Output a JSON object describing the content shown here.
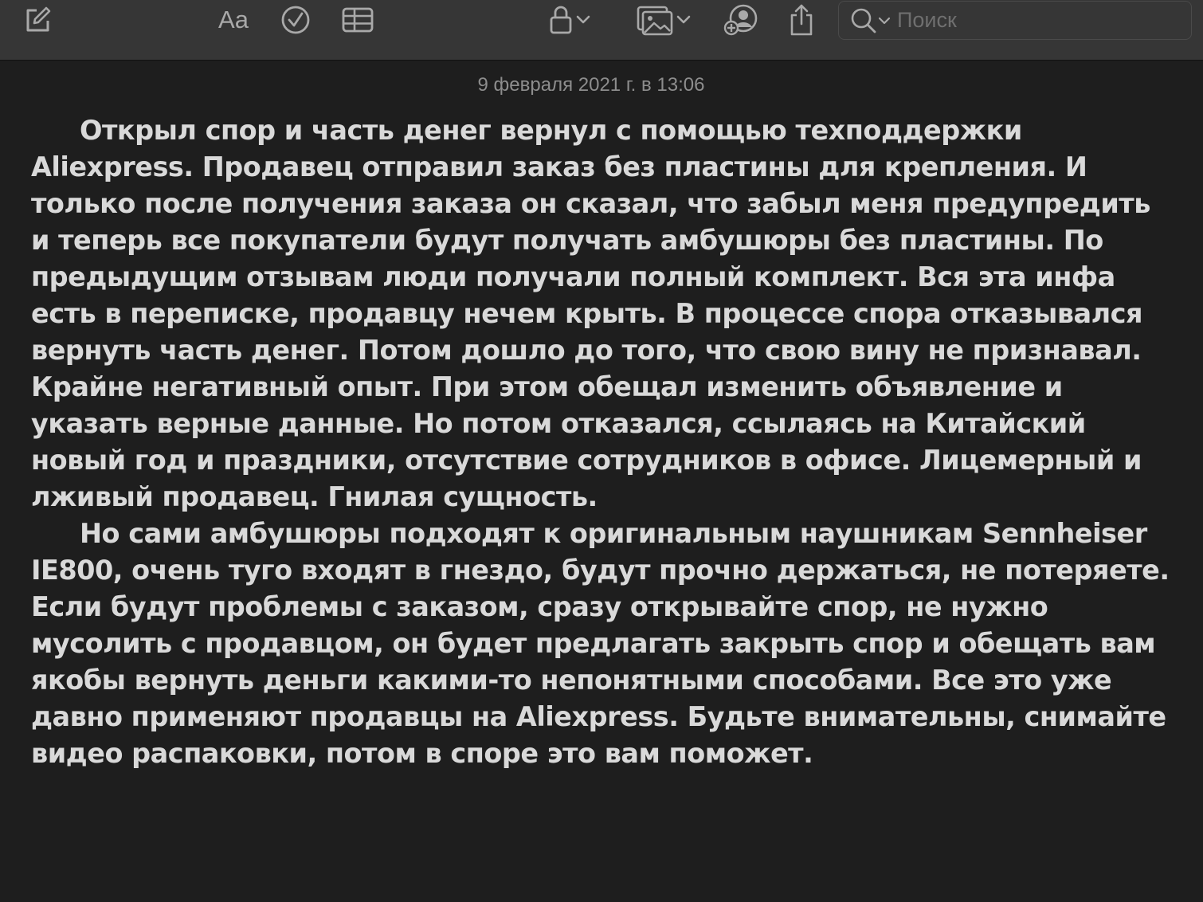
{
  "toolbar": {
    "format_label": "Aa",
    "search_placeholder": "Поиск"
  },
  "note": {
    "date": "9 февраля 2021 г. в 13:06",
    "paragraphs": [
      "Открыл спор и часть денег вернул с помощью техподдержки Aliexpress. Продавец отправил заказ без пластины для крепления. И только после получения заказа он сказал, что забыл меня предупредить и теперь все покупатели будут получать амбушюры без пластины. По предыдущим отзывам люди получали полный комплект. Вся эта инфа есть в переписке, продавцу нечем крыть. В процессе спора отказывался вернуть часть денег. Потом дошло до того, что свою вину не признавал. Крайне негативный опыт. При этом обещал изменить объявление и указать верные данные. Но потом отказался, ссылаясь на Китайский новый год и праздники, отсутствие сотрудников в офисе. Лицемерный и лживый продавец. Гнилая сущность.",
      "Но сами амбушюры подходят к оригинальным наушникам Sennheiser IE800, очень туго входят в гнездо, будут прочно держаться, не потеряете. Если будут проблемы с заказом, сразу открывайте спор, не нужно мусолить с продавцом, он будет предлагать закрыть спор и обещать вам якобы вернуть деньги какими-то непонятными способами. Все это уже давно применяют продавцы на Aliexpress. Будьте внимательны, снимайте видео распаковки, потом в споре это вам поможет."
    ]
  },
  "colors": {
    "toolbar_bg": "#363636",
    "note_bg": "#1e1e1e",
    "text": "#d9d9d9",
    "icon": "#a9a9a9"
  },
  "icons": [
    "compose-icon",
    "checklist-icon",
    "table-icon",
    "lock-icon",
    "media-icon",
    "collaborate-icon",
    "share-icon",
    "search-icon"
  ]
}
